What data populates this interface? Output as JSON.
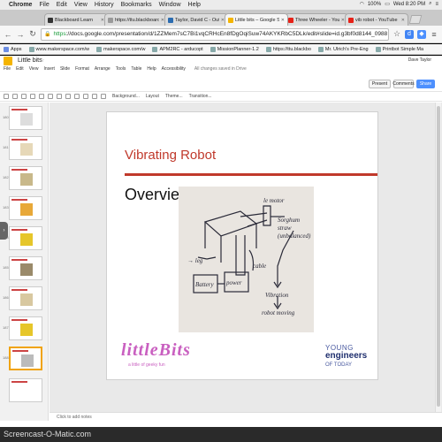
{
  "macmenu": {
    "apple": "",
    "items": [
      "Chrome",
      "File",
      "Edit",
      "View",
      "History",
      "Bookmarks",
      "Window",
      "Help"
    ],
    "battery": "100%",
    "clock": "Wed 8:20 PM"
  },
  "tabs": [
    {
      "title": "Blackboard Learn",
      "color": "#333333"
    },
    {
      "title": "https://ttu.blackboard",
      "color": "#999999"
    },
    {
      "title": "Taylor, David C - Outlook",
      "color": "#2b6cb0"
    },
    {
      "title": "Little bits – Google Slides",
      "color": "#f4b400",
      "active": true
    },
    {
      "title": "Three Wheeler - YouTube",
      "color": "#e62117"
    },
    {
      "title": "vib robot - YouTube",
      "color": "#e62117"
    }
  ],
  "address": {
    "https": "https",
    "url": "://docs.google.com/presentation/d/1ZZMem7sC7Bi1vqCRHcEn8fDgOqiSuw74AKYKRbC5DLk/edit#slide=id.g3bf0d8144_0988"
  },
  "bookmarks": [
    "Apps",
    "www.makerspace.com/w",
    "makerspace.com/w",
    "APM2RC - arducopt",
    "MissionPlanner-1.2",
    "https://ttu.blackbo",
    "Mr. Ulrich's Pre-Eng",
    "Printbot Simple Ma"
  ],
  "slides_app": {
    "doc_title": "Little bits",
    "user": "Dave Taylor",
    "menu": [
      "File",
      "Edit",
      "View",
      "Insert",
      "Slide",
      "Format",
      "Arrange",
      "Tools",
      "Table",
      "Help",
      "Accessibility"
    ],
    "saved_status": "All changes saved in Drive",
    "present": "Present",
    "comments": "Comments",
    "share": "Share",
    "toolbar": [
      "Background...",
      "Layout",
      "Theme...",
      "Transition..."
    ]
  },
  "slide": {
    "title": "Vibrating Robot",
    "subtitle": "Overview",
    "logo_left": "littleBits",
    "tagline": "a little of geeky fun",
    "logo_right_line1": "YOUNG",
    "logo_right_line2": "engineers",
    "logo_right_line3": "OF TODAY"
  },
  "notes_placeholder": "Click to add notes",
  "watermark": "Screencast-O-Matic.com",
  "thumbnail_numbers": [
    "180",
    "181",
    "182",
    "183",
    "184",
    "185",
    "186",
    "187",
    "188"
  ]
}
